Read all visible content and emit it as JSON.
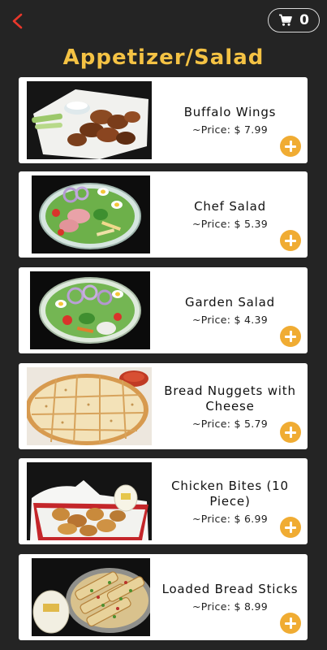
{
  "header": {
    "title": "Appetizer/Salad",
    "cart_count": "0",
    "accent_color": "#f4c244",
    "back_icon_color": "#e8372b"
  },
  "items": [
    {
      "name": "Buffalo Wings",
      "price": "~Price: $ 7.99",
      "image": "buffalo-wings-photo"
    },
    {
      "name": "Chef Salad",
      "price": "~Price: $ 5.39",
      "image": "chef-salad-photo"
    },
    {
      "name": "Garden Salad",
      "price": "~Price: $ 4.39",
      "image": "garden-salad-photo"
    },
    {
      "name": "Bread Nuggets with Cheese",
      "price": "~Price: $ 5.79",
      "image": "bread-nuggets-photo"
    },
    {
      "name": "Chicken Bites (10 Piece)",
      "price": "~Price: $ 6.99",
      "image": "chicken-bites-photo"
    },
    {
      "name": "Loaded Bread Sticks",
      "price": "~Price: $ 8.99",
      "image": "bread-sticks-photo"
    }
  ],
  "add_button_color": "#f0ac33"
}
